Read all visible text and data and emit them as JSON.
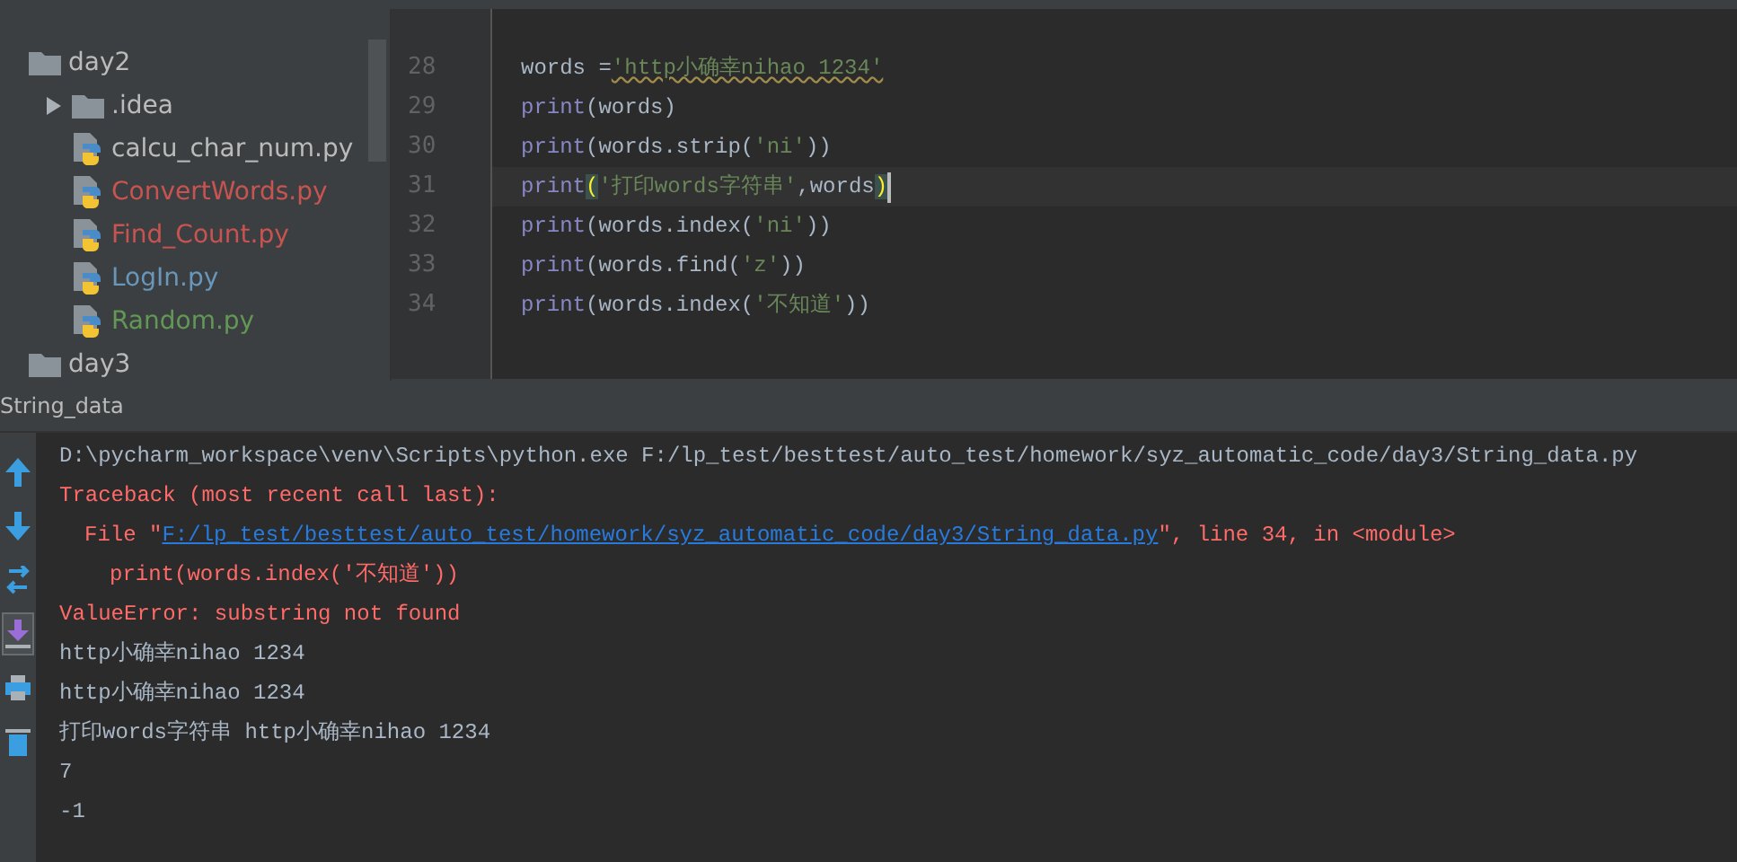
{
  "project_tree": [
    {
      "kind": "folder",
      "label": "day2",
      "color": "#bbbbbb",
      "children": [
        {
          "kind": "folder",
          "label": ".idea",
          "color": "#bbbbbb",
          "expanded": false
        },
        {
          "kind": "file",
          "label": "calcu_char_num.py",
          "color": "#bbbbbb"
        },
        {
          "kind": "file",
          "label": "ConvertWords.py",
          "color": "#c75450"
        },
        {
          "kind": "file",
          "label": "Find_Count.py",
          "color": "#c75450"
        },
        {
          "kind": "file",
          "label": "LogIn.py",
          "color": "#6897bb"
        },
        {
          "kind": "file",
          "label": "Random.py",
          "color": "#629755"
        }
      ]
    },
    {
      "kind": "folder",
      "label": "day3",
      "color": "#bbbbbb"
    }
  ],
  "editor": {
    "lines": [
      {
        "number": "28",
        "current": false,
        "tokens": [
          {
            "kind": "plain",
            "text": "words ="
          },
          {
            "kind": "string_warn",
            "text": "'http小确幸nihao 1234'"
          }
        ]
      },
      {
        "number": "29",
        "current": false,
        "tokens": [
          {
            "kind": "builtin",
            "text": "print"
          },
          {
            "kind": "plain",
            "text": "(words)"
          }
        ]
      },
      {
        "number": "30",
        "current": false,
        "tokens": [
          {
            "kind": "builtin",
            "text": "print"
          },
          {
            "kind": "plain",
            "text": "(words.strip("
          },
          {
            "kind": "string",
            "text": "'ni'"
          },
          {
            "kind": "plain",
            "text": "))"
          }
        ]
      },
      {
        "number": "31",
        "current": true,
        "tokens": [
          {
            "kind": "builtin",
            "text": "print"
          },
          {
            "kind": "match",
            "text": "("
          },
          {
            "kind": "string",
            "text": "'打印words字符串'"
          },
          {
            "kind": "plain",
            "text": ",words"
          },
          {
            "kind": "match",
            "text": ")"
          }
        ]
      },
      {
        "number": "32",
        "current": false,
        "tokens": [
          {
            "kind": "builtin",
            "text": "print"
          },
          {
            "kind": "plain",
            "text": "(words.index("
          },
          {
            "kind": "string",
            "text": "'ni'"
          },
          {
            "kind": "plain",
            "text": "))"
          }
        ]
      },
      {
        "number": "33",
        "current": false,
        "tokens": [
          {
            "kind": "builtin",
            "text": "print"
          },
          {
            "kind": "plain",
            "text": "(words.find("
          },
          {
            "kind": "string",
            "text": "'z'"
          },
          {
            "kind": "plain",
            "text": "))"
          }
        ]
      },
      {
        "number": "34",
        "current": false,
        "tokens": [
          {
            "kind": "builtin",
            "text": "print"
          },
          {
            "kind": "plain",
            "text": "(words.index("
          },
          {
            "kind": "string",
            "text": "'不知道'"
          },
          {
            "kind": "plain",
            "text": "))"
          }
        ]
      }
    ]
  },
  "run_panel": {
    "title": "String_data",
    "toolbar": [
      {
        "kind": "up",
        "selected": false
      },
      {
        "kind": "down",
        "selected": false
      },
      {
        "kind": "wrap",
        "selected": false
      },
      {
        "kind": "scroll-end",
        "selected": true
      },
      {
        "kind": "print",
        "selected": false
      },
      {
        "kind": "trash",
        "selected": false
      }
    ],
    "output": [
      {
        "kind": "line",
        "segments": [
          {
            "kind": "plain",
            "text": "D:\\pycharm_workspace\\venv\\Scripts\\python.exe F:/lp_test/besttest/auto_test/homework/syz_automatic_code/day3/String_data.py"
          }
        ]
      },
      {
        "kind": "line",
        "segments": [
          {
            "kind": "error",
            "text": "Traceback (most recent call last):"
          }
        ]
      },
      {
        "kind": "frame",
        "segments": [
          {
            "kind": "error",
            "text": "File \""
          },
          {
            "kind": "link",
            "text": "F:/lp_test/besttest/auto_test/homework/syz_automatic_code/day3/String_data.py"
          },
          {
            "kind": "error",
            "text": "\", line 34, in <module>"
          }
        ]
      },
      {
        "kind": "source",
        "segments": [
          {
            "kind": "error",
            "text": "print(words.index('不知道'))"
          }
        ]
      },
      {
        "kind": "line",
        "segments": [
          {
            "kind": "error",
            "text": "ValueError: substring not found"
          }
        ]
      },
      {
        "kind": "line",
        "segments": [
          {
            "kind": "plain",
            "text": "http小确幸nihao 1234"
          }
        ]
      },
      {
        "kind": "line",
        "segments": [
          {
            "kind": "plain",
            "text": "http小确幸nihao 1234"
          }
        ]
      },
      {
        "kind": "line",
        "segments": [
          {
            "kind": "plain",
            "text": "打印words字符串 http小确幸nihao 1234"
          }
        ]
      },
      {
        "kind": "line",
        "segments": [
          {
            "kind": "plain",
            "text": "7"
          }
        ]
      },
      {
        "kind": "line",
        "segments": [
          {
            "kind": "plain",
            "text": "-1"
          }
        ]
      }
    ]
  }
}
